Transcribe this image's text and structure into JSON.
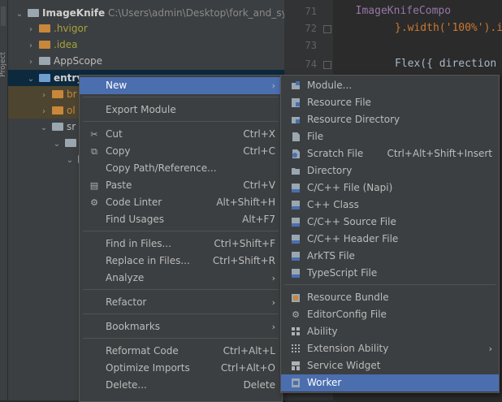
{
  "tree": {
    "root_name": "ImageKnife",
    "root_path": "C:\\Users\\admin\\Desktop\\fork_and_syn",
    "items": [
      ".hvigor",
      ".idea",
      "AppScope",
      "entry",
      "br",
      "ol",
      "sr"
    ]
  },
  "toolstrip": {
    "label": "Project"
  },
  "editor": {
    "lines": [
      {
        "num": "71",
        "code": "  ImageKnifeCompo"
      },
      {
        "num": "72",
        "code": "}.width('100%').i"
      },
      {
        "num": "73",
        "code": ""
      },
      {
        "num": "74",
        "code": "Flex({ direction"
      }
    ]
  },
  "context_menu": {
    "items": [
      {
        "label": "New",
        "shortcut": "",
        "arrow": true
      },
      {
        "label": "Export Module",
        "shortcut": ""
      },
      {
        "label": "Cut",
        "shortcut": "Ctrl+X",
        "icon": "cut-icon"
      },
      {
        "label": "Copy",
        "shortcut": "Ctrl+C",
        "icon": "copy-icon"
      },
      {
        "label": "Copy Path/Reference...",
        "shortcut": ""
      },
      {
        "label": "Paste",
        "shortcut": "Ctrl+V",
        "icon": "paste-icon"
      },
      {
        "label": "Code Linter",
        "shortcut": "Alt+Shift+H",
        "icon": "code-linter-icon"
      },
      {
        "label": "Find Usages",
        "shortcut": "Alt+F7"
      },
      {
        "label": "Find in Files...",
        "shortcut": "Ctrl+Shift+F"
      },
      {
        "label": "Replace in Files...",
        "shortcut": "Ctrl+Shift+R"
      },
      {
        "label": "Analyze",
        "shortcut": "",
        "arrow": true
      },
      {
        "label": "Refactor",
        "shortcut": "",
        "arrow": true
      },
      {
        "label": "Bookmarks",
        "shortcut": "",
        "arrow": true
      },
      {
        "label": "Reformat Code",
        "shortcut": "Ctrl+Alt+L"
      },
      {
        "label": "Optimize Imports",
        "shortcut": "Ctrl+Alt+O"
      },
      {
        "label": "Delete...",
        "shortcut": "Delete"
      }
    ]
  },
  "new_submenu": {
    "items": [
      {
        "label": "Module...",
        "icon": "module-icon"
      },
      {
        "label": "Resource File",
        "icon": "resource-file-icon"
      },
      {
        "label": "Resource Directory",
        "icon": "resource-directory-icon"
      },
      {
        "label": "File",
        "icon": "file-icon"
      },
      {
        "label": "Scratch File",
        "shortcut": "Ctrl+Alt+Shift+Insert",
        "icon": "scratch-file-icon"
      },
      {
        "label": "Directory",
        "icon": "directory-icon"
      },
      {
        "label": "C/C++ File (Napi)",
        "icon": "cpp-napi-icon"
      },
      {
        "label": "C++ Class",
        "icon": "cpp-class-icon"
      },
      {
        "label": "C/C++ Source File",
        "icon": "cpp-source-icon"
      },
      {
        "label": "C/C++ Header File",
        "icon": "cpp-header-icon"
      },
      {
        "label": "ArkTS File",
        "icon": "arkts-icon"
      },
      {
        "label": "TypeScript File",
        "icon": "typescript-icon"
      },
      {
        "label": "Resource Bundle",
        "icon": "resource-bundle-icon"
      },
      {
        "label": "EditorConfig File",
        "icon": "editorconfig-icon"
      },
      {
        "label": "Ability",
        "icon": "ability-icon"
      },
      {
        "label": "Extension Ability",
        "arrow": true,
        "icon": "extension-ability-icon"
      },
      {
        "label": "Service Widget",
        "icon": "service-widget-icon"
      },
      {
        "label": "Worker",
        "icon": "worker-icon"
      }
    ]
  },
  "colors": {
    "accent": "#4b6eaf",
    "menu_bg": "#3c3f41",
    "editor_bg": "#2b2b2b"
  }
}
